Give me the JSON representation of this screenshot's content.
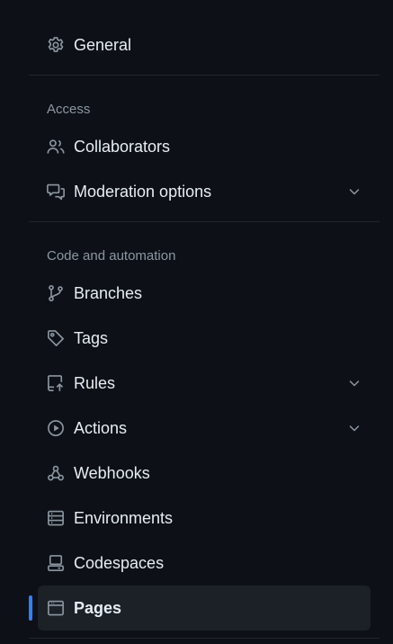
{
  "nav": {
    "general": {
      "label": "General",
      "icon": "gear-icon"
    },
    "access": {
      "heading": "Access",
      "items": [
        {
          "label": "Collaborators",
          "icon": "people-icon"
        },
        {
          "label": "Moderation options",
          "icon": "comment-discussion-icon",
          "expandable": true
        }
      ]
    },
    "code_automation": {
      "heading": "Code and automation",
      "items": [
        {
          "label": "Branches",
          "icon": "git-branch-icon"
        },
        {
          "label": "Tags",
          "icon": "tag-icon"
        },
        {
          "label": "Rules",
          "icon": "repo-push-icon",
          "expandable": true
        },
        {
          "label": "Actions",
          "icon": "play-icon",
          "expandable": true
        },
        {
          "label": "Webhooks",
          "icon": "webhook-icon"
        },
        {
          "label": "Environments",
          "icon": "server-icon"
        },
        {
          "label": "Codespaces",
          "icon": "codespaces-icon"
        },
        {
          "label": "Pages",
          "icon": "browser-icon",
          "active": true
        }
      ]
    }
  },
  "colors": {
    "background": "#0d1117",
    "active_background": "#1c2128",
    "accent": "#2f81f7",
    "text": "#e6edf3",
    "muted": "#8d96a0",
    "divider": "#21262d"
  }
}
